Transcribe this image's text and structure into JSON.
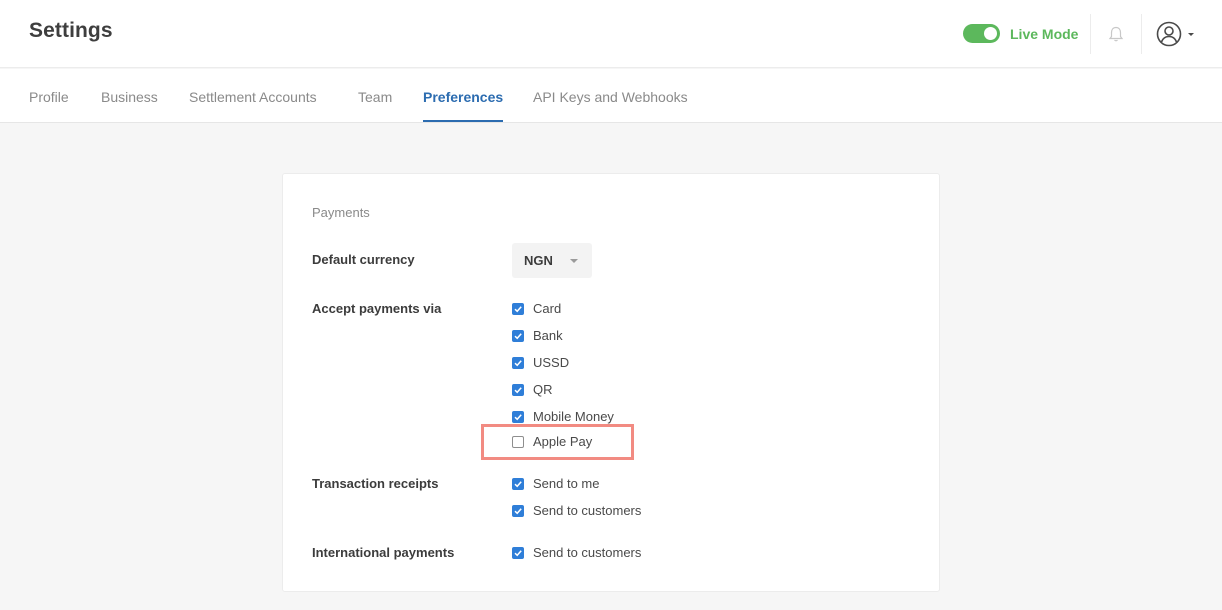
{
  "header": {
    "title": "Settings",
    "live_mode_label": "Live Mode",
    "live_mode_on": true,
    "accent_color": "#5cb85c",
    "icons": [
      "bell-icon",
      "user-avatar-icon",
      "caret-down-icon"
    ]
  },
  "tabs": [
    {
      "label": "Profile",
      "active": false
    },
    {
      "label": "Business",
      "active": false
    },
    {
      "label": "Settlement Accounts",
      "active": false
    },
    {
      "label": "Team",
      "active": false
    },
    {
      "label": "Preferences",
      "active": true
    },
    {
      "label": "API Keys and Webhooks",
      "active": false
    }
  ],
  "payments": {
    "section_title": "Payments",
    "default_currency": {
      "label": "Default currency",
      "value": "NGN"
    },
    "accept_payments": {
      "label": "Accept payments via",
      "options": [
        {
          "label": "Card",
          "checked": true
        },
        {
          "label": "Bank",
          "checked": true
        },
        {
          "label": "USSD",
          "checked": true
        },
        {
          "label": "QR",
          "checked": true
        },
        {
          "label": "Mobile Money",
          "checked": true
        },
        {
          "label": "Apple Pay",
          "checked": false
        }
      ]
    },
    "transaction_receipts": {
      "label": "Transaction receipts",
      "options": [
        {
          "label": "Send to me",
          "checked": true
        },
        {
          "label": "Send to customers",
          "checked": true
        }
      ]
    },
    "international_payments": {
      "label": "International payments",
      "options": [
        {
          "label": "Send to customers",
          "checked": true
        }
      ]
    }
  },
  "colors": {
    "checkbox_checked": "#2f7ed8",
    "active_tab": "#2c6cb0",
    "highlight_box": "#f28b82"
  }
}
